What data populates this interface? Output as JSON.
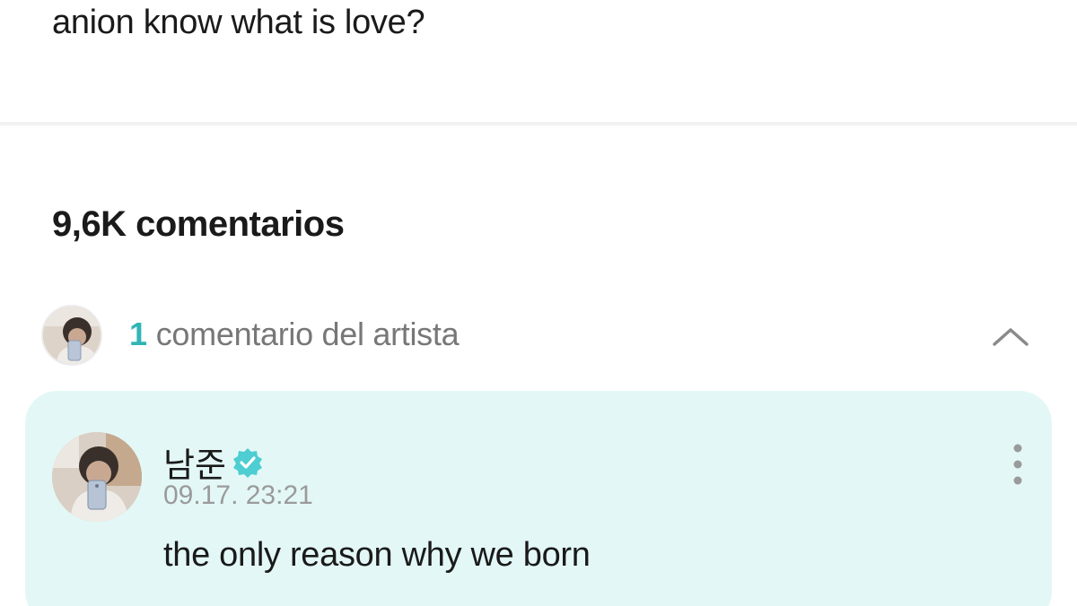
{
  "post": {
    "text": "anion know what is love?"
  },
  "comments": {
    "count_label": "9,6K comentarios"
  },
  "artist_section": {
    "count": "1",
    "label": "comentario del artista",
    "collapse_icon": "chevron-up-icon"
  },
  "artist_comment": {
    "author": "남준",
    "verified_icon": "verified-badge-icon",
    "timestamp": "09.17. 23:21",
    "body": "the only reason why we born",
    "more_icon": "more-vertical-icon"
  },
  "colors": {
    "accent": "#2fb5b5",
    "card_background": "#e3f8f6",
    "muted_text": "#9a9a9a"
  }
}
